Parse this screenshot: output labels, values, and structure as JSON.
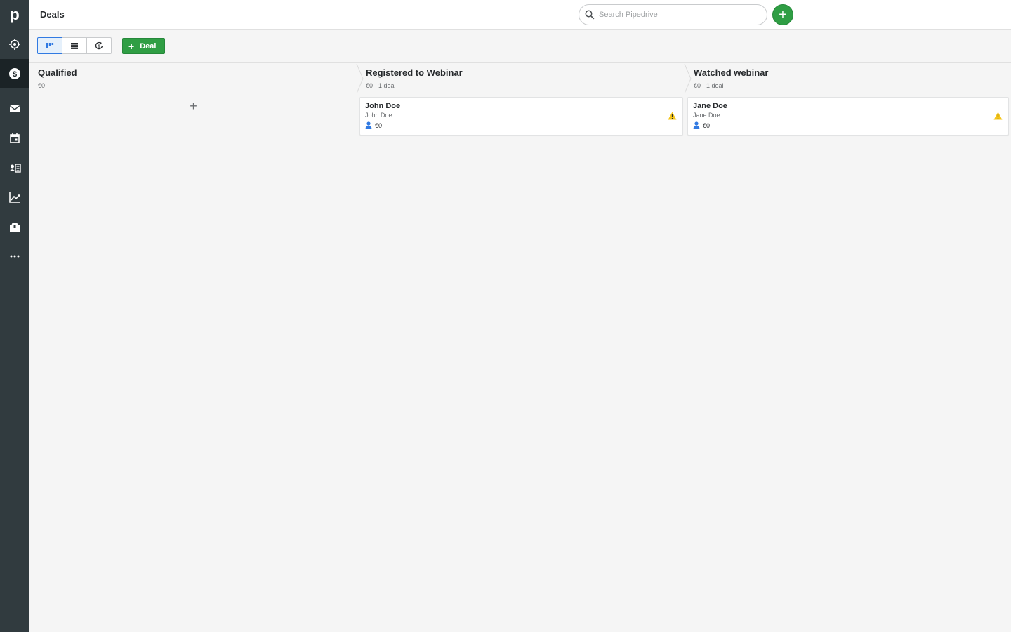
{
  "app": {
    "logo_letter": "p",
    "page_title": "Deals"
  },
  "sidebar": {
    "items": [
      {
        "name": "leads-icon"
      },
      {
        "name": "deals-icon",
        "active": true
      },
      {
        "name": "mail-icon"
      },
      {
        "name": "calendar-icon"
      },
      {
        "name": "contacts-icon"
      },
      {
        "name": "insights-icon"
      },
      {
        "name": "products-icon"
      },
      {
        "name": "more-icon"
      }
    ]
  },
  "search": {
    "placeholder": "Search Pipedrive",
    "value": ""
  },
  "toolbar": {
    "views": [
      {
        "name": "pipeline-view-icon",
        "active": true
      },
      {
        "name": "list-view-icon",
        "active": false
      },
      {
        "name": "forecast-view-icon",
        "active": false
      }
    ],
    "add_deal_label": "Deal",
    "add_deal_plus": "+"
  },
  "stages": [
    {
      "name": "Qualified",
      "meta": "€0",
      "add_symbol": "+",
      "deals": []
    },
    {
      "name": "Registered to Webinar",
      "meta": "€0 · 1 deal",
      "deals": [
        {
          "title": "John Doe",
          "person": "John Doe",
          "value": "€0",
          "warning": true
        }
      ]
    },
    {
      "name": "Watched webinar",
      "meta": "€0 · 1 deal",
      "deals": [
        {
          "title": "Jane Doe",
          "person": "Jane Doe",
          "value": "€0",
          "warning": true
        }
      ]
    }
  ],
  "colors": {
    "sidebar_bg": "#313b3f",
    "accent_green": "#2f9e44",
    "accent_blue": "#317ae2",
    "warning_yellow": "#f5c518",
    "person_icon_blue": "#317ae2"
  }
}
